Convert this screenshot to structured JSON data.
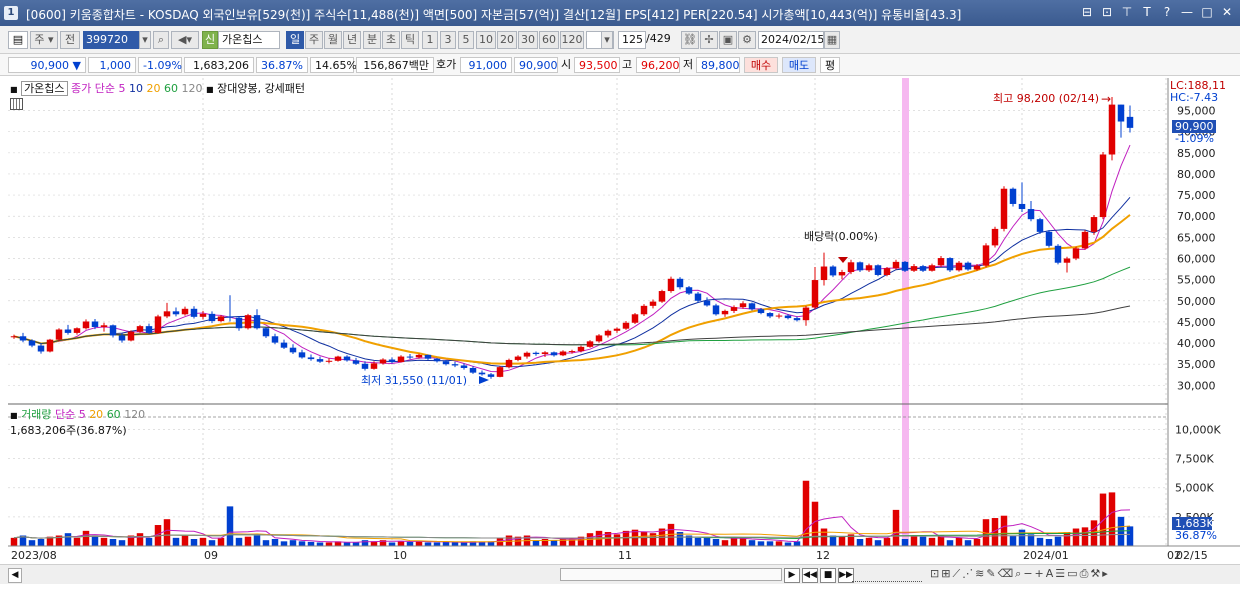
{
  "window": {
    "number": "1",
    "title": "[0600] 키움종합차트 - KOSDAQ 외국인보유[529(천)] 주식수[11,488(천)] 액면[500] 자본금[57(억)] 결산[12월] EPS[412] PER[220.54] 시가총액[10,443(억)] 유통비율[43.3]",
    "controls": [
      "⊟",
      "⊡",
      "⊤",
      "T",
      "?",
      "—",
      "□",
      "✕"
    ]
  },
  "toolbar": {
    "period_type": "주",
    "prev_label": "전",
    "code_value": "399720",
    "name_value": "가온칩스",
    "name_badge": "신",
    "period_buttons": [
      "일",
      "주",
      "월",
      "년",
      "분",
      "초",
      "틱"
    ],
    "active_period": "일",
    "interval_buttons": [
      "1",
      "3",
      "5",
      "10",
      "20",
      "30",
      "60",
      "120"
    ],
    "count_value": "125",
    "count_total": "/429",
    "date_value": "2024/02/15"
  },
  "quote": {
    "price": "90,900",
    "arrow": "▼",
    "change": "1,000",
    "change_pct": "-1.09%",
    "volume": "1,683,206",
    "vol_ratio": "36.87%",
    "turnover": "14.65%",
    "amount": "156,867백만",
    "ask_label": "호가",
    "ask": "91,000",
    "bid": "90,900",
    "open_label": "시",
    "open": "93,500",
    "high_label": "고",
    "high": "96,200",
    "low_label": "저",
    "low": "89,800",
    "buy_label": "매수",
    "sell_label": "매도",
    "eval_label": "평"
  },
  "price_legend": {
    "name": "가온칩스",
    "ma_label": "종가 단순",
    "ma_periods": [
      "5",
      "10",
      "20",
      "60",
      "120"
    ],
    "pattern_label": "장대양봉, 강세패턴"
  },
  "volume_legend": {
    "name": "거래량",
    "ma_label": "단순",
    "ma_periods": [
      "5",
      "20",
      "60",
      "120"
    ],
    "value_label": "1,683,206주(36.87%)"
  },
  "annotations": {
    "high": "최고 98,200 (02/14)",
    "low": "최저 31,550 (11/01)",
    "dividend": "배당락(0.00%)",
    "lc": "LC:188,11",
    "hc": "HC:-7.43",
    "last_price": "90,900",
    "last_pct": "-1.09%",
    "last_volume": "1,683K",
    "last_vol_pct": "36.87%"
  },
  "colors": {
    "up": "#e00000",
    "down": "#0040d0",
    "ma5": "#c020c0",
    "ma10": "#1030a0",
    "ma20": "#f0a000",
    "ma60": "#20a040",
    "ma120": "#404040",
    "highlight": "#f6b8f0"
  },
  "x_axis": {
    "labels": [
      "2023/08",
      "09",
      "10",
      "11",
      "12",
      "2024/01",
      "02"
    ],
    "last_date": "02/15"
  },
  "chart_data": [
    {
      "type": "candlestick",
      "ylabel": "",
      "ylim": [
        27000,
        98200
      ],
      "y_ticks": [
        "95,000",
        "90,000",
        "85,000",
        "80,000",
        "75,000",
        "70,000",
        "65,000",
        "60,000",
        "55,000",
        "50,000",
        "45,000",
        "40,000",
        "35,000",
        "30,000"
      ],
      "ohlc": [
        [
          41500,
          42000,
          41000,
          41600
        ],
        [
          41600,
          42400,
          40200,
          40600
        ],
        [
          40600,
          40900,
          39000,
          39400
        ],
        [
          39400,
          40000,
          37500,
          38000
        ],
        [
          38000,
          41000,
          37800,
          40800
        ],
        [
          40800,
          43500,
          40500,
          43200
        ],
        [
          43200,
          44300,
          42000,
          42400
        ],
        [
          42400,
          43700,
          42000,
          43500
        ],
        [
          43500,
          45600,
          43200,
          45100
        ],
        [
          45100,
          45700,
          43300,
          43800
        ],
        [
          43800,
          44800,
          42700,
          44200
        ],
        [
          44200,
          44400,
          41300,
          41800
        ],
        [
          41800,
          42400,
          40100,
          40600
        ],
        [
          40600,
          43000,
          40400,
          42700
        ],
        [
          42700,
          44300,
          42400,
          44000
        ],
        [
          44000,
          44600,
          42100,
          42400
        ],
        [
          42400,
          46700,
          42200,
          46300
        ],
        [
          46300,
          49500,
          45900,
          47500
        ],
        [
          47500,
          48400,
          46300,
          46800
        ],
        [
          46800,
          48600,
          46500,
          48100
        ],
        [
          48100,
          48700,
          45800,
          46200
        ],
        [
          46200,
          47600,
          45600,
          46900
        ],
        [
          46900,
          47500,
          44700,
          45200
        ],
        [
          45200,
          46600,
          44900,
          46300
        ],
        [
          46300,
          51300,
          45100,
          46000
        ],
        [
          46000,
          46300,
          42900,
          43500
        ],
        [
          43500,
          46900,
          43200,
          46600
        ],
        [
          46600,
          48000,
          43200,
          43500
        ],
        [
          43500,
          43700,
          41200,
          41600
        ],
        [
          41600,
          42200,
          39700,
          40100
        ],
        [
          40100,
          40800,
          38600,
          38900
        ],
        [
          38900,
          39700,
          37400,
          37800
        ],
        [
          37800,
          38400,
          36300,
          36600
        ],
        [
          36600,
          37300,
          35800,
          36200
        ],
        [
          36200,
          36800,
          35300,
          35600
        ],
        [
          35600,
          36400,
          35200,
          35800
        ],
        [
          35800,
          37000,
          35600,
          36800
        ],
        [
          36800,
          37100,
          35600,
          35900
        ],
        [
          35900,
          36500,
          34800,
          35100
        ],
        [
          35100,
          35700,
          33500,
          33900
        ],
        [
          33900,
          35700,
          33700,
          35200
        ],
        [
          35200,
          36400,
          34900,
          36100
        ],
        [
          36100,
          36600,
          35200,
          35500
        ],
        [
          35500,
          37100,
          35400,
          36800
        ],
        [
          36800,
          37400,
          36200,
          36600
        ],
        [
          36600,
          37500,
          36300,
          37200
        ],
        [
          37200,
          37300,
          36000,
          36300
        ],
        [
          36300,
          36500,
          35400,
          35700
        ],
        [
          35700,
          36000,
          34700,
          35000
        ],
        [
          35000,
          35600,
          34300,
          34700
        ],
        [
          34700,
          35200,
          33700,
          34100
        ],
        [
          34100,
          34500,
          32700,
          33000
        ],
        [
          33000,
          33500,
          32300,
          32600
        ],
        [
          32600,
          32900,
          31550,
          32000
        ],
        [
          32000,
          34600,
          31900,
          34300
        ],
        [
          34300,
          36300,
          34000,
          36000
        ],
        [
          36000,
          37100,
          35700,
          36800
        ],
        [
          36800,
          38000,
          36300,
          37700
        ],
        [
          37700,
          38000,
          37000,
          37400
        ],
        [
          37400,
          38100,
          36700,
          37800
        ],
        [
          37800,
          38000,
          36800,
          37100
        ],
        [
          37100,
          38300,
          36900,
          38000
        ],
        [
          38000,
          38400,
          37500,
          38100
        ],
        [
          38100,
          39400,
          37800,
          39100
        ],
        [
          39100,
          40700,
          38900,
          40400
        ],
        [
          40400,
          42100,
          40100,
          41800
        ],
        [
          41800,
          43200,
          41300,
          42900
        ],
        [
          42900,
          43700,
          42400,
          43400
        ],
        [
          43400,
          45200,
          43100,
          44800
        ],
        [
          44800,
          47100,
          44500,
          46800
        ],
        [
          46800,
          49200,
          46400,
          48800
        ],
        [
          48800,
          50300,
          48200,
          49800
        ],
        [
          49800,
          52600,
          49500,
          52300
        ],
        [
          52300,
          55700,
          51900,
          55200
        ],
        [
          55200,
          55600,
          52700,
          53200
        ],
        [
          53200,
          53500,
          51400,
          51700
        ],
        [
          51700,
          52100,
          49600,
          50000
        ],
        [
          50000,
          50800,
          48600,
          48900
        ],
        [
          48900,
          49300,
          46500,
          46800
        ],
        [
          46800,
          47900,
          46200,
          47600
        ],
        [
          47600,
          48900,
          47100,
          48500
        ],
        [
          48500,
          49900,
          48100,
          49400
        ],
        [
          49400,
          49600,
          47700,
          48000
        ],
        [
          48000,
          48300,
          46800,
          47100
        ],
        [
          47100,
          47300,
          45900,
          46300
        ],
        [
          46300,
          47000,
          45800,
          46500
        ],
        [
          46500,
          46800,
          45600,
          45900
        ],
        [
          45900,
          46300,
          45100,
          45400
        ],
        [
          45400,
          48800,
          44100,
          48400
        ],
        [
          48400,
          58000,
          48000,
          54900
        ],
        [
          54900,
          61400,
          53600,
          58100
        ],
        [
          58100,
          58400,
          55600,
          56000
        ],
        [
          56000,
          57300,
          55100,
          56800
        ],
        [
          56800,
          59700,
          56300,
          59100
        ],
        [
          59100,
          59300,
          56800,
          57200
        ],
        [
          57200,
          58800,
          56800,
          58400
        ],
        [
          58400,
          58600,
          55800,
          56100
        ],
        [
          56100,
          58000,
          55800,
          57700
        ],
        [
          57700,
          59700,
          57400,
          59200
        ],
        [
          59200,
          59400,
          56800,
          57100
        ],
        [
          57100,
          58700,
          56800,
          58200
        ],
        [
          58200,
          58500,
          56800,
          57100
        ],
        [
          57100,
          58800,
          56900,
          58400
        ],
        [
          58400,
          60600,
          58000,
          60100
        ],
        [
          60100,
          60300,
          56800,
          57200
        ],
        [
          57200,
          59400,
          56900,
          59000
        ],
        [
          59000,
          59300,
          57100,
          57400
        ],
        [
          57400,
          58700,
          57100,
          58300
        ],
        [
          58300,
          63600,
          57900,
          63100
        ],
        [
          63100,
          67500,
          62600,
          67000
        ],
        [
          67000,
          77100,
          66400,
          76500
        ],
        [
          76500,
          76800,
          72300,
          72900
        ],
        [
          72900,
          78000,
          71000,
          71700
        ],
        [
          71700,
          73600,
          68800,
          69300
        ],
        [
          69300,
          69600,
          65800,
          66300
        ],
        [
          66300,
          66700,
          62600,
          63000
        ],
        [
          63000,
          63400,
          58600,
          59000
        ],
        [
          59000,
          60400,
          56700,
          60000
        ],
        [
          60000,
          62800,
          59600,
          62400
        ],
        [
          62400,
          66700,
          62100,
          66300
        ],
        [
          66300,
          70300,
          65600,
          69800
        ],
        [
          69800,
          85200,
          69300,
          84600
        ],
        [
          84600,
          98200,
          83200,
          96400
        ],
        [
          96400,
          96400,
          88600,
          92400
        ],
        [
          93500,
          96200,
          89800,
          90900
        ]
      ]
    },
    {
      "type": "bar",
      "ylabel": "",
      "ylim": [
        0,
        11500
      ],
      "y_ticks": [
        "10,000K",
        "7,500K",
        "5,000K",
        "2,500K"
      ],
      "values": [
        700,
        900,
        500,
        600,
        800,
        900,
        1100,
        700,
        1300,
        900,
        700,
        600,
        500,
        900,
        1100,
        700,
        1800,
        2300,
        700,
        900,
        600,
        700,
        500,
        700,
        3400,
        700,
        800,
        900,
        500,
        600,
        400,
        500,
        400,
        350,
        300,
        300,
        400,
        300,
        300,
        500,
        400,
        500,
        300,
        400,
        350,
        450,
        300,
        300,
        350,
        300,
        300,
        400,
        350,
        400,
        700,
        900,
        800,
        900,
        500,
        600,
        500,
        600,
        700,
        800,
        1100,
        1300,
        1200,
        1000,
        1300,
        1400,
        1200,
        1100,
        1500,
        1900,
        1200,
        900,
        700,
        800,
        600,
        500,
        700,
        700,
        500,
        400,
        400,
        400,
        300,
        400,
        5600,
        3800,
        1500,
        900,
        800,
        1000,
        600,
        700,
        500,
        700,
        3100,
        600,
        900,
        800,
        700,
        900,
        500,
        700,
        500,
        600,
        2300,
        2400,
        2600,
        900,
        1400,
        1000,
        700,
        600,
        800,
        1200,
        1500,
        1600,
        2200,
        4500,
        4600,
        2500,
        1683
      ]
    }
  ]
}
